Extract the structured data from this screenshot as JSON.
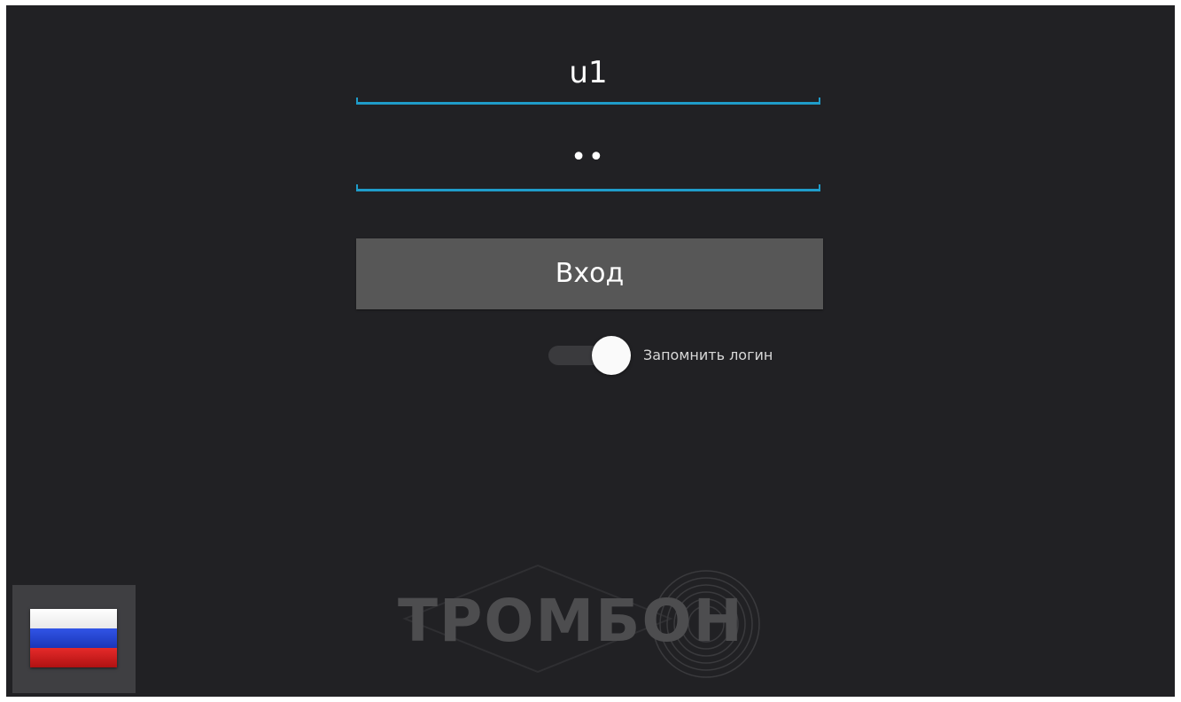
{
  "login": {
    "value": "u1",
    "password_mask": "••"
  },
  "submit": {
    "label": "Вход"
  },
  "remember": {
    "label": "Запомнить логин",
    "enabled": true
  },
  "language": {
    "current": "ru",
    "flag_colors": [
      "#ffffff",
      "#1c3fd6",
      "#d71b1b"
    ]
  },
  "branding": {
    "logo_text": "ТРОМБОН"
  },
  "colors": {
    "background": "#212124",
    "accent": "#1f9cc9",
    "button": "#575757"
  }
}
